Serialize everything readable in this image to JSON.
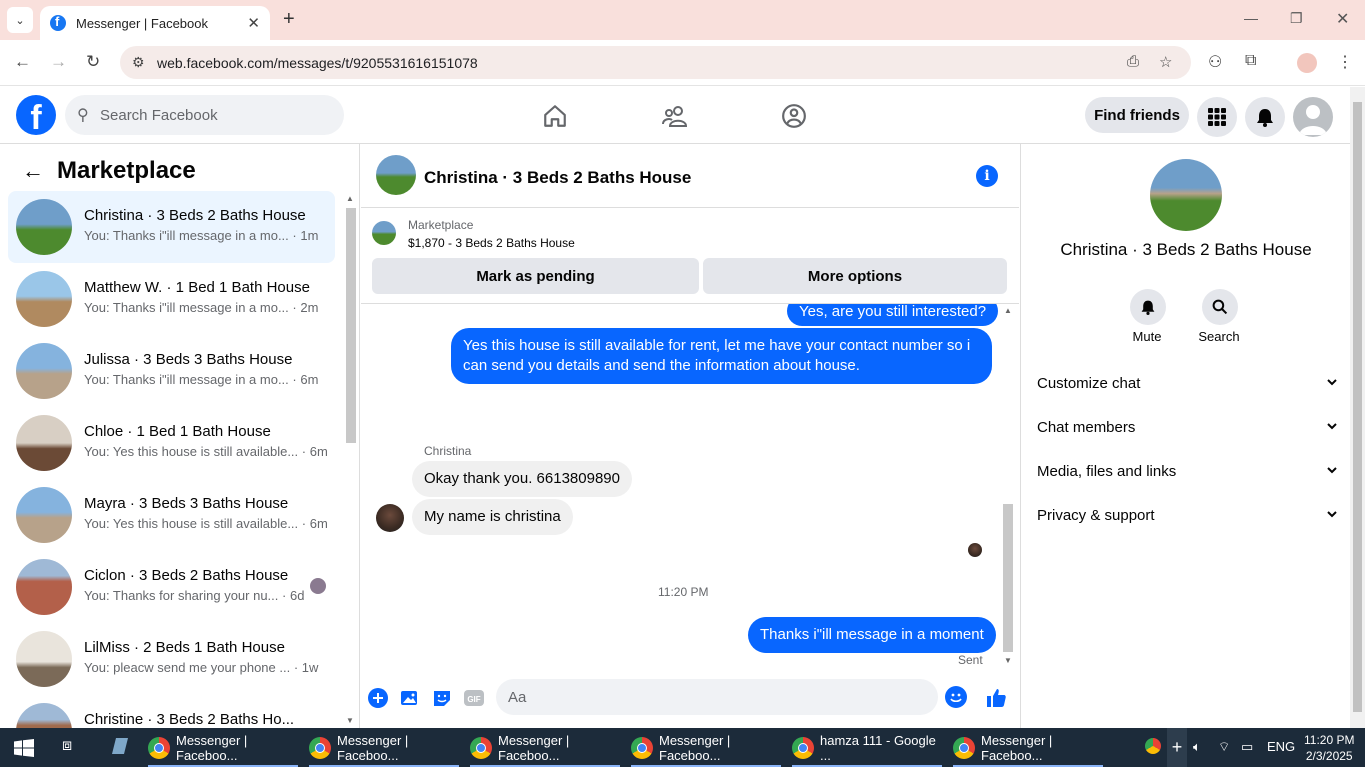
{
  "browser": {
    "tab_title": "Messenger | Facebook",
    "url": "web.facebook.com/messages/t/9205531616151078"
  },
  "fb": {
    "search_placeholder": "Search Facebook",
    "find_friends": "Find friends"
  },
  "left": {
    "title": "Marketplace",
    "conversations": [
      {
        "name": "Christina · 3 Beds 2 Baths House",
        "preview": "You: Thanks i\"ill message in a mo...",
        "time": "· 1m",
        "colors": [
          "#6f9ec9",
          "#4d8a2e"
        ]
      },
      {
        "name": "Matthew W. · 1 Bed 1 Bath House",
        "preview": "You: Thanks i\"ill message in a mo...",
        "time": "· 2m",
        "colors": [
          "#9ac6e8",
          "#b08a60"
        ]
      },
      {
        "name": "Julissa · 3 Beds 3 Baths House",
        "preview": "You: Thanks i\"ill message in a mo...",
        "time": "· 6m",
        "colors": [
          "#85b3de",
          "#b7a28a"
        ]
      },
      {
        "name": "Chloe · 1 Bed 1 Bath House",
        "preview": "You: Yes this house is still available...",
        "time": "· 6m",
        "colors": [
          "#d8cfc4",
          "#6b4a36"
        ]
      },
      {
        "name": "Mayra · 3 Beds 3 Baths House",
        "preview": "You: Yes this house is still available...",
        "time": "· 6m",
        "colors": [
          "#85b3de",
          "#b7a28a"
        ]
      },
      {
        "name": "Ciclon · 3 Beds 2 Baths House",
        "preview": "You: Thanks for sharing your nu...",
        "time": "· 6d",
        "colors": [
          "#9fb9d6",
          "#b3604a"
        ]
      },
      {
        "name": "LilMiss · 2 Beds 1 Bath House",
        "preview": "You: pleacw send me your phone ...",
        "time": "· 1w",
        "colors": [
          "#e9e4dc",
          "#7b6a58"
        ]
      },
      {
        "name": "Christine · 3 Beds 2 Baths Ho...",
        "preview": "",
        "time": "",
        "colors": [
          "#9fb9d6",
          "#a06a4c"
        ]
      }
    ]
  },
  "chat": {
    "title": "Christina · 3 Beds 2 Baths House",
    "listing_tag": "Marketplace",
    "listing_price": "$1,870 - 3 Beds 2 Baths House",
    "btn_pending": "Mark as pending",
    "btn_more": "More options",
    "msg1": "Yes, are you still interested?",
    "msg2": "Yes this house is still available for rent, let me have your contact number so i can send you details and send the information about house.",
    "sender": "Christina",
    "msg3": "Okay thank you. 6613809890",
    "msg4": "My name is christina",
    "timestamp": "11:20 PM",
    "msg5": "Thanks i\"ill message in a moment",
    "sent": "Sent",
    "composer_placeholder": "Aa"
  },
  "right": {
    "name": "Christina · 3 Beds 2 Baths House",
    "mute": "Mute",
    "search": "Search",
    "sections": [
      "Customize chat",
      "Chat members",
      "Media, files and links",
      "Privacy & support"
    ]
  },
  "taskbar": {
    "apps": [
      "Messenger | Faceboo...",
      "Messenger | Faceboo...",
      "Messenger | Faceboo...",
      "Messenger | Faceboo...",
      "hamza 111 - Google ...",
      "Messenger | Faceboo..."
    ],
    "lang": "ENG",
    "time": "11:20 PM",
    "date": "2/3/2025"
  }
}
